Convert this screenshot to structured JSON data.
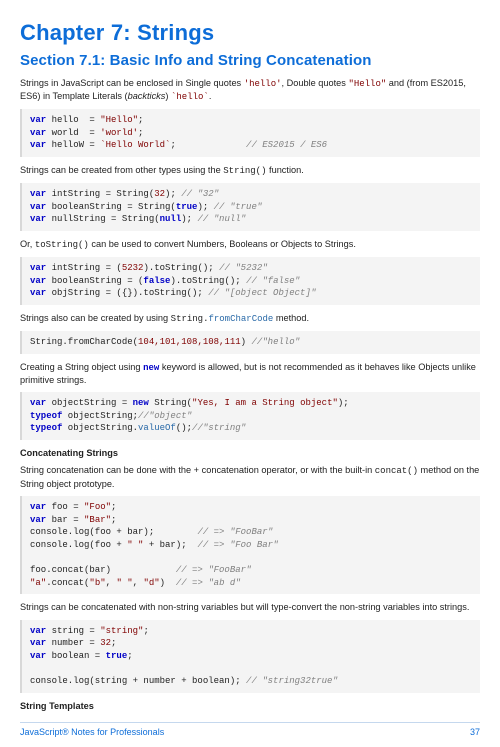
{
  "h1": "Chapter 7: Strings",
  "h2": "Section 7.1: Basic Info and String Concatenation",
  "p1a": "Strings in JavaScript can be enclosed in Single quotes ",
  "p1c1": "'hello'",
  "p1b": ", Double quotes ",
  "p1c2": "\"Hello\"",
  "p1c": " and (from ES2015, ES6) in Template Literals (",
  "p1i": "backticks",
  "p1d": ") ",
  "p1c3": "`hello`",
  "p1e": ".",
  "code1": {
    "var": "var",
    "hello": " hello  = ",
    "s1": "\"Hello\"",
    "world": " world  = ",
    "s2": "'world'",
    "hw": " helloW = ",
    "s3": "`Hello World`",
    "c1": "             // ES2015 / ES6"
  },
  "p2a": "Strings can be created from other types using the ",
  "p2m": "String()",
  "p2b": " function.",
  "code2": {
    "var": "var",
    "l1": " intString = String(",
    "n1": "32",
    "l1b": "); ",
    "c1": "// \"32\"",
    "l2": " booleanString = String(",
    "b1": "true",
    "l2b": "); ",
    "c2": "// \"true\"",
    "l3": " nullString = String(",
    "nu": "null",
    "l3b": "); ",
    "c3": "// \"null\""
  },
  "p3a": "Or, ",
  "p3m": "toString()",
  "p3b": " can be used to convert Numbers, Booleans or Objects to Strings.",
  "code3": {
    "var": "var",
    "l1": " intString = (",
    "n1": "5232",
    "l1b": ").toString(); ",
    "c1": "// \"5232\"",
    "l2": " booleanString = (",
    "b1": "false",
    "l2b": ").toString(); ",
    "c2": "// \"false\"",
    "l3": " objString = ({}).toString(); ",
    "c3": "// \"[object Object]\""
  },
  "p4a": "Strings also can be created by using ",
  "p4m": "String.",
  "p4m2": "fromCharCode",
  "p4b": " method.",
  "code4": {
    "pre": "String.fromCharCode(",
    "nums": "104,101,108,108,111",
    "post": ") ",
    "c": "//\"hello\""
  },
  "p5a": "Creating a String object using ",
  "p5n": "new",
  "p5b": " keyword is allowed, but is not recommended as it behaves like Objects unlike primitive strings.",
  "code5": {
    "var": "var",
    "l1": " objectString = ",
    "new": "new",
    "l1b": " String(",
    "s1": "\"Yes, I am a String object\"",
    "l1c": ");",
    "to": "typeof",
    "l2": " objectString;",
    "c1": "//\"object\"",
    "l3": " objectString.",
    "vo": "valueOf",
    "l3b": "();",
    "c2": "//\"string\""
  },
  "sub1": "Concatenating Strings",
  "p6a": "String concatenation can be done with the ",
  "p6m": "+",
  "p6b": " concatenation operator, or with the built-in ",
  "p6m2": "concat()",
  "p6c": " method on the String object prototype.",
  "code6": {
    "var": "var",
    "foo": " foo = ",
    "s1": "\"Foo\"",
    "bar": " bar = ",
    "s2": "\"Bar\"",
    "l3a": "console.log(foo + bar);        ",
    "c1": "// => \"FooBar\"",
    "l4a": "console.log(foo + ",
    "s3": "\" \"",
    "l4b": " + bar);  ",
    "c2": "// => \"Foo Bar\"",
    "l5a": "foo.concat(bar)            ",
    "c3": "// => \"FooBar\"",
    "s4": "\"a\"",
    "l6a": ".concat(",
    "s5": "\"b\"",
    "l6b": ", ",
    "s6": "\" \"",
    "l6c": ", ",
    "s7": "\"d\"",
    "l6d": ")  ",
    "c4": "// => \"ab d\""
  },
  "p7": "Strings can be concatenated with non-string variables but will type-convert the non-string variables into strings.",
  "code7": {
    "var": "var",
    "l1": " string = ",
    "s1": "\"string\"",
    "l2": " number = ",
    "n1": "32",
    "l3": " boolean = ",
    "b1": "true",
    "l4": "console.log(string + number + boolean); ",
    "c1": "// \"string32true\""
  },
  "sub2": "String Templates",
  "footer_l": "JavaScript® Notes for Professionals",
  "footer_r": "37"
}
